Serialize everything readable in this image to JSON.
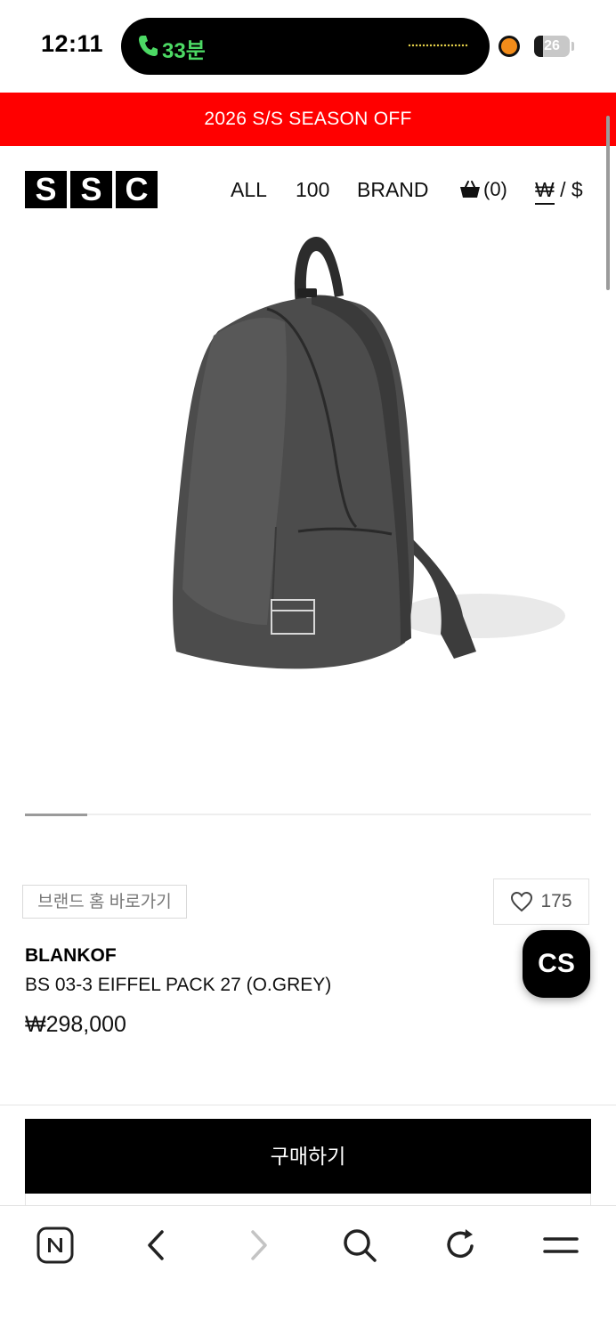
{
  "status": {
    "time": "12:11",
    "call_duration": "33분",
    "battery_level": "26",
    "battery_fraction": 0.26
  },
  "promo": {
    "text": "2026 S/S SEASON OFF",
    "bg_color": "#ff0000"
  },
  "header": {
    "logo_letters": [
      "S",
      "S",
      "C"
    ],
    "nav": {
      "all": "ALL",
      "hundred": "100",
      "brand": "BRAND"
    },
    "cart_count": "(0)",
    "currency_won": "₩",
    "currency_sep": " / ",
    "currency_usd": "$"
  },
  "carousel": {
    "active_fraction": 0.11
  },
  "product": {
    "brand_home_label": "브랜드 홈 바로가기",
    "like_count": "175",
    "brand": "BLANKOF",
    "name": "BS 03-3 EIFFEL PACK 27 (O.GREY)",
    "price": "₩298,000"
  },
  "cs_label": "CS",
  "buy_label": "구매하기",
  "toolbar": {
    "icons": [
      "naver-n-icon",
      "back-arrow-icon",
      "forward-arrow-icon",
      "search-icon",
      "reload-icon",
      "menu-icon"
    ]
  }
}
